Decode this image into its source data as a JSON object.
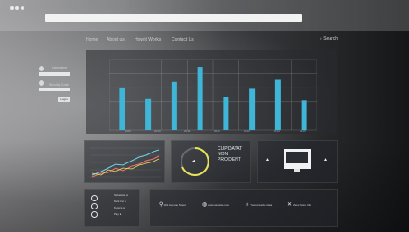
{
  "browser": {
    "traffic_lights": 3
  },
  "nav": {
    "items": [
      "Home",
      "About us",
      "How it Works",
      "Contact Us"
    ],
    "search_label": "Search"
  },
  "login": {
    "username_label": "Username",
    "password_label": "Security Code",
    "button_label": "Login"
  },
  "main_chart": {
    "x_ticks": [
      "2009",
      "2010",
      "2011",
      "2012",
      "2013",
      "2014",
      "2015"
    ]
  },
  "chart_data": {
    "type": "bar",
    "categories": [
      "",
      "",
      "",
      "",
      "",
      "",
      "",
      "",
      "",
      ""
    ],
    "values": [
      0.62,
      0.45,
      0.7,
      0.92,
      0.48,
      0.6,
      0.73,
      0.43
    ],
    "ylim": [
      0,
      1
    ],
    "grid": true
  },
  "gauge": {
    "icon": "speaker-icon"
  },
  "headline": {
    "lines": [
      "CUPIDATAT",
      "NON",
      "PROIDENT"
    ]
  },
  "slider_labels": [
    "Sebastian",
    "Dark Inc",
    "Musics",
    "Play"
  ],
  "features": [
    {
      "icon": "location-pin-icon",
      "label": "101 Avenue Street"
    },
    {
      "icon": "globe-icon",
      "label": "www.website.com"
    },
    {
      "icon": "lightbulb-icon",
      "label": "Your creative idea"
    },
    {
      "icon": "tools-icon",
      "label": "Show More Info"
    }
  ],
  "colors": {
    "accent": "#3fb6d8",
    "gauge": "#e8e35a"
  }
}
